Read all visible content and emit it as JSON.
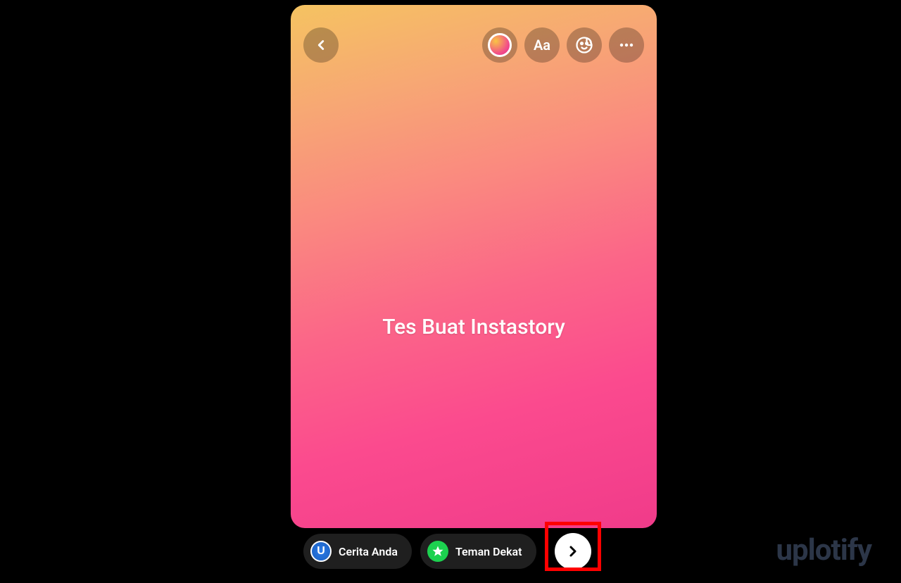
{
  "story": {
    "overlay_text": "Tes Buat Instastory"
  },
  "toolbar": {
    "text_tool_label": "Aa"
  },
  "bottom": {
    "your_story_label": "Cerita Anda",
    "close_friends_label": "Teman Dekat"
  },
  "watermark": {
    "text": "uplotify"
  },
  "icons": {
    "back": "chevron-left",
    "gradient": "color-gradient-circle",
    "text": "Aa",
    "sticker": "sticker-smiley",
    "more": "ellipsis",
    "avatar_letter": "U",
    "star": "star",
    "send": "chevron-right"
  },
  "colors": {
    "gradient_top": "#f5c361",
    "gradient_bottom": "#f03b8a",
    "close_friends": "#1cd14f",
    "highlight": "#ff0000",
    "watermark": "#2c3648"
  }
}
